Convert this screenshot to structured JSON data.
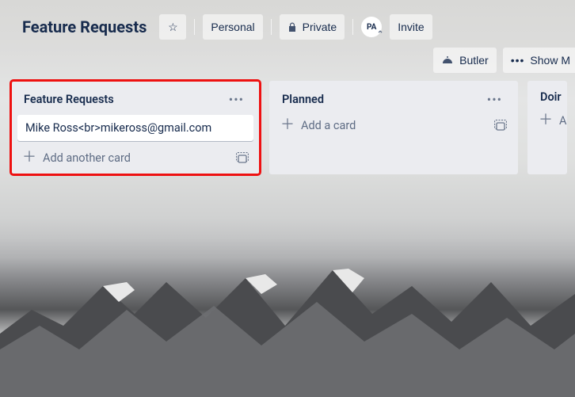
{
  "header": {
    "board_title": "Feature Requests",
    "personal_label": "Personal",
    "private_label": "Private",
    "invite_label": "Invite",
    "avatar_initials": "PA"
  },
  "subheader": {
    "butler_label": "Butler",
    "show_menu_label": "Show M"
  },
  "lists": [
    {
      "title": "Feature Requests",
      "cards": [
        {
          "text": "Mike Ross<br>mikeross@gmail.com"
        }
      ],
      "add_label": "Add another card",
      "highlight": true
    },
    {
      "title": "Planned",
      "cards": [],
      "add_label": "Add a card",
      "highlight": false
    },
    {
      "title": "Doir",
      "cards": [],
      "add_label": "A",
      "highlight": false
    }
  ]
}
